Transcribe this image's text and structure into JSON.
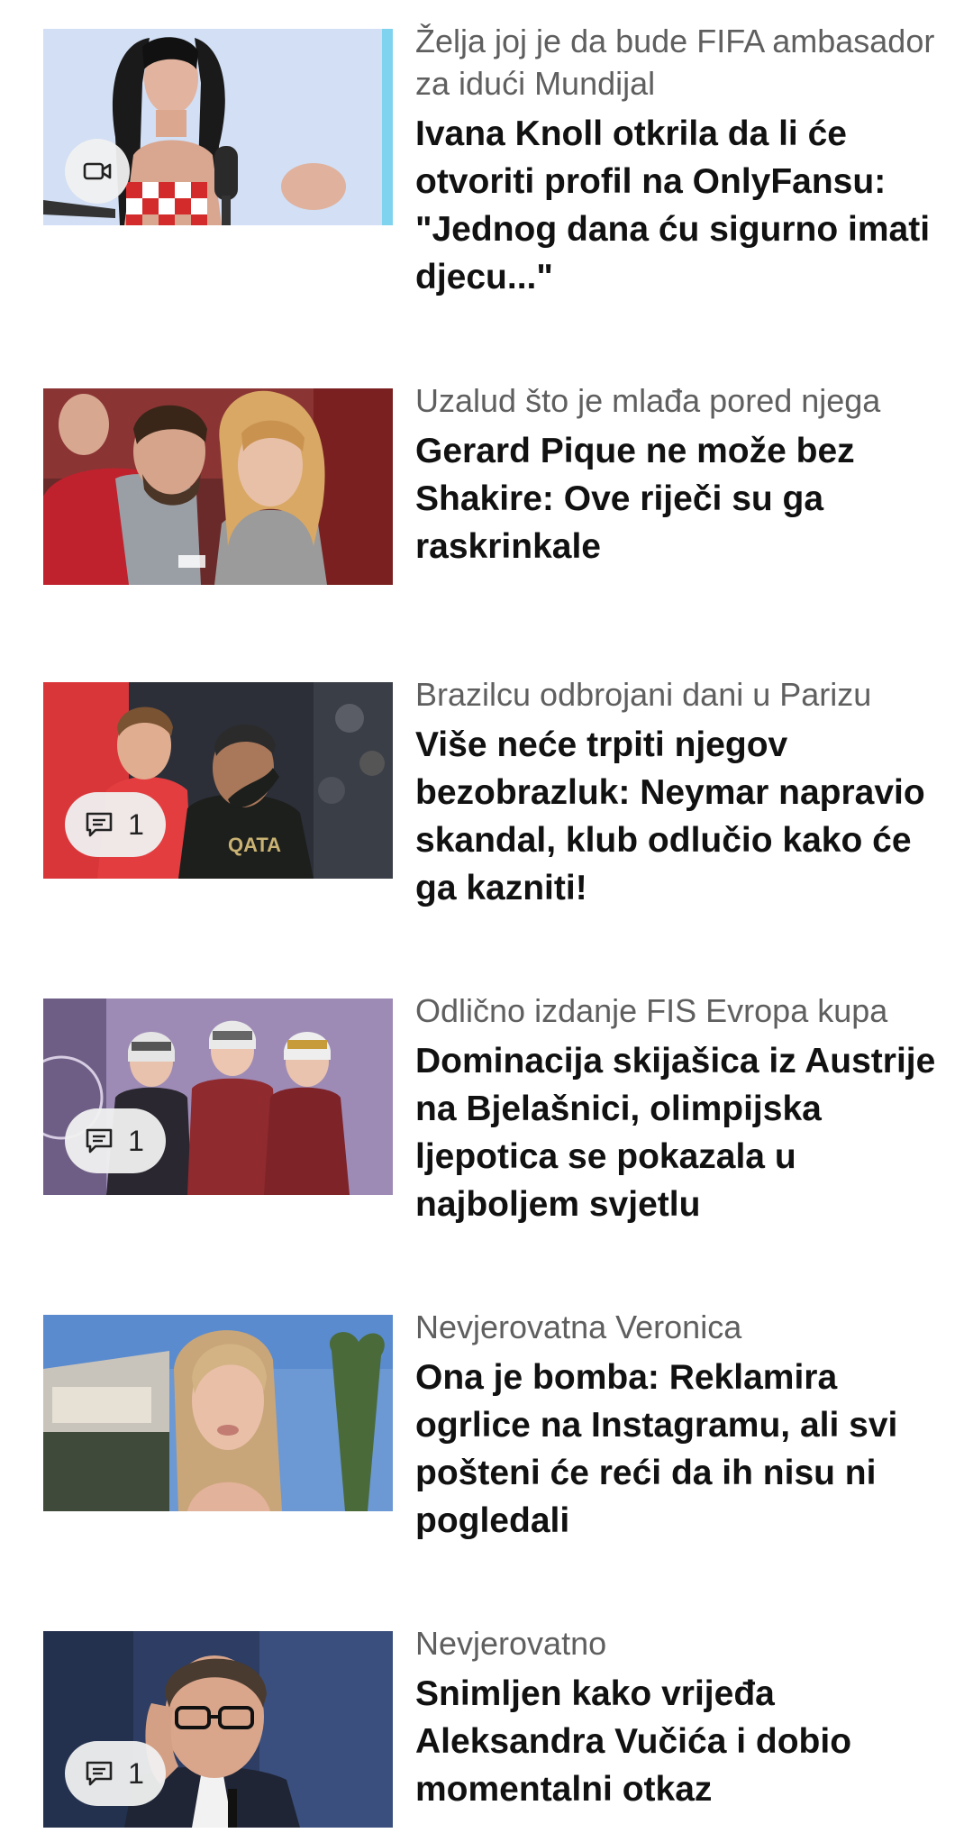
{
  "articles": [
    {
      "kicker": "Želja joj je da bude FIFA ambasador za idući Mundijal",
      "headline": "Ivana Knoll otkrila da li će otvoriti profil na OnlyFansu: \"Jednog dana ću sigurno imati djecu...\"",
      "badge": {
        "type": "video",
        "icon": "video-camera-icon"
      }
    },
    {
      "kicker": "Uzalud što je mlađa pored njega",
      "headline": "Gerard Pique ne može bez Shakire: Ove riječi su ga raskrinkale",
      "badge": null
    },
    {
      "kicker": "Brazilcu odbrojani dani u Parizu",
      "headline": "Više neće trpiti njegov bezobrazluk: Neymar napravio skandal, klub odlučio kako će ga kazniti!",
      "badge": {
        "type": "comments",
        "icon": "comment-icon",
        "count": "1"
      }
    },
    {
      "kicker": "Odlično izdanje FIS Evropa kupa",
      "headline": "Dominacija skijašica iz Austrije na Bjelašnici, olimpijska ljepotica se pokazala u najboljem svjetlu",
      "badge": {
        "type": "comments",
        "icon": "comment-icon",
        "count": "1"
      }
    },
    {
      "kicker": "Nevjerovatna Veronica",
      "headline": "Ona je bomba: Reklamira ogrlice na Instagramu, ali svi pošteni će reći da ih nisu ni pogledali",
      "badge": null
    },
    {
      "kicker": "Nevjerovatno",
      "headline": "Snimljen kako vrijeđa Aleksandra Vučića i dobio momentalni otkaz",
      "badge": {
        "type": "comments",
        "icon": "comment-icon",
        "count": "1"
      }
    }
  ]
}
